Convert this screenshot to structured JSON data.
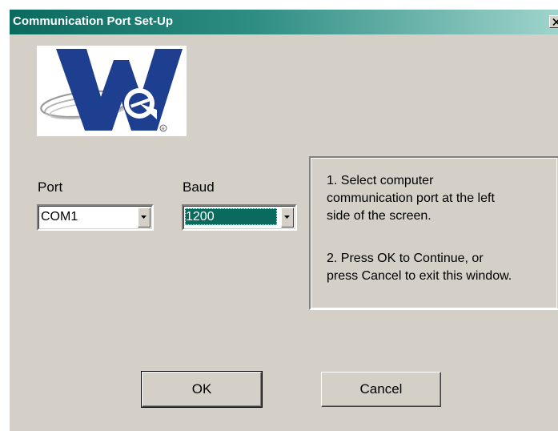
{
  "window": {
    "title": "Communication Port Set-Up",
    "close_glyph": "✕"
  },
  "logo": {
    "icon": "we-company-logo",
    "colors": {
      "blue": "#1e3f8f",
      "grey": "#a8a8a8"
    }
  },
  "port": {
    "label": "Port",
    "value": "COM1"
  },
  "baud": {
    "label": "Baud",
    "value": "1200"
  },
  "instructions": {
    "line1": "1.  Select computer",
    "line2": "communication port at the left",
    "line3": "side of the screen.",
    "line4": "2.  Press OK to Continue, or",
    "line5": "press Cancel to exit this window."
  },
  "buttons": {
    "ok_label": "OK",
    "cancel_label": "Cancel"
  },
  "colors": {
    "title_bar": "#0a6a5e",
    "dialog_bg": "#d4d0c8",
    "selection": "#0a6a5e"
  }
}
